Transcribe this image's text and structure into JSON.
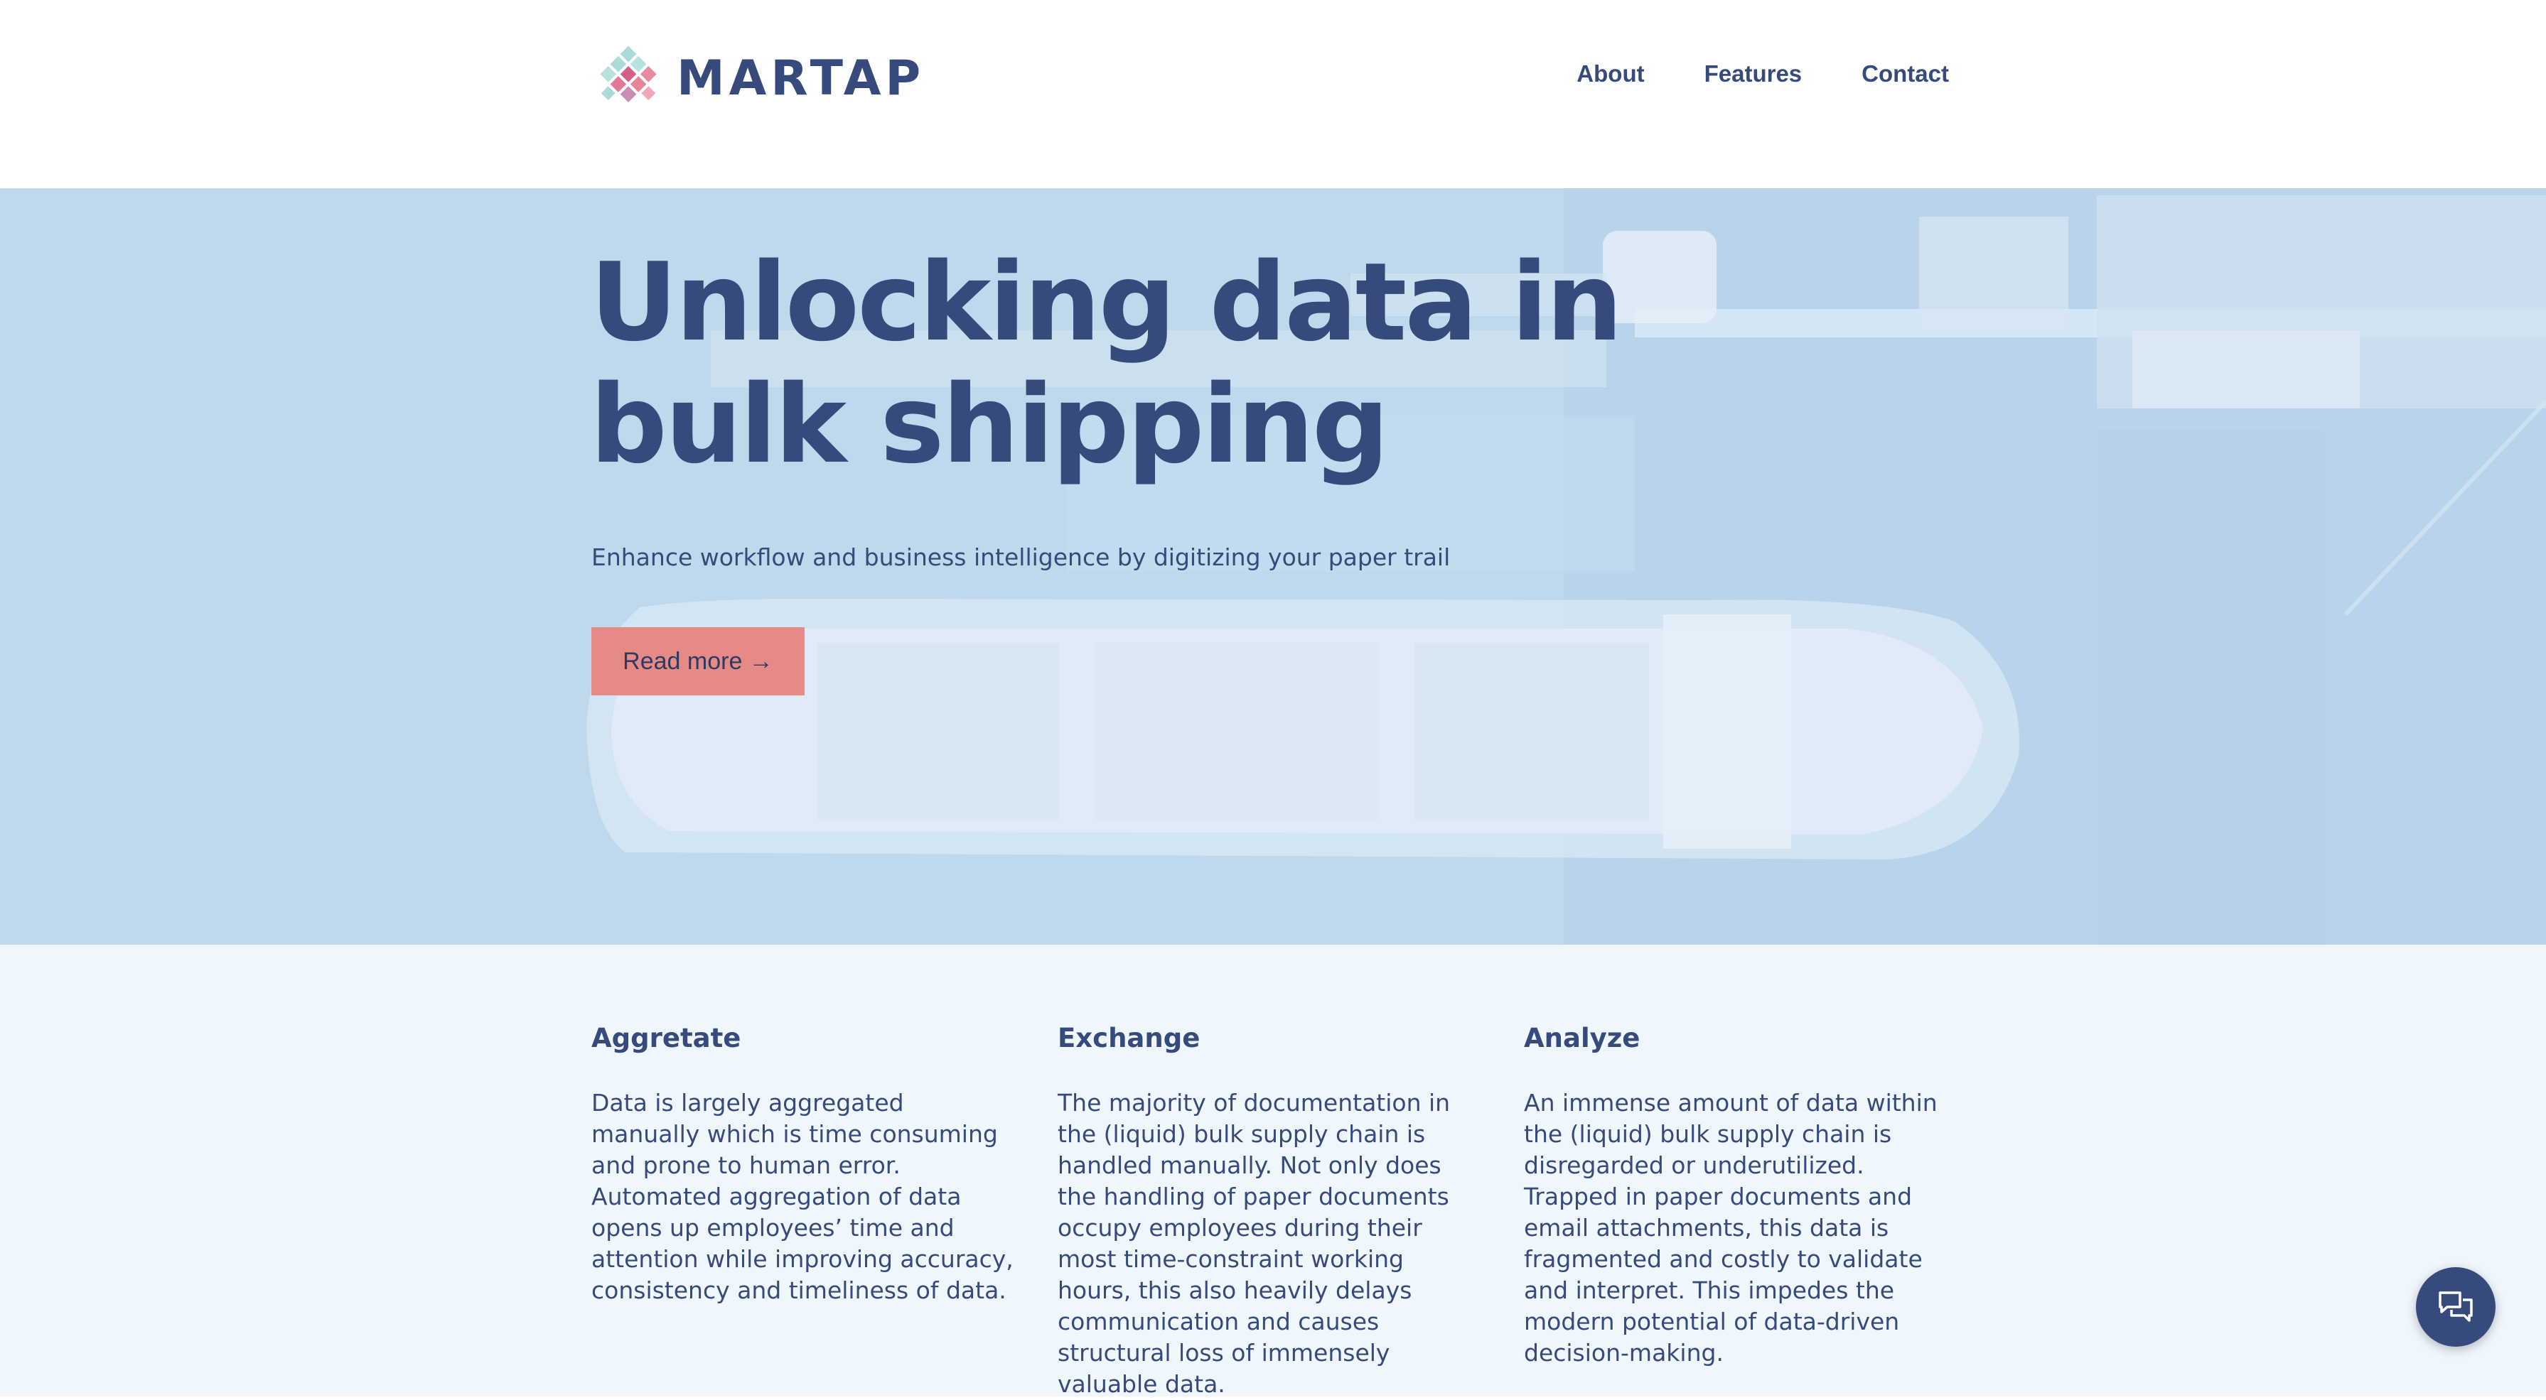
{
  "brand": {
    "name": "MARTAP"
  },
  "nav": {
    "items": [
      "About",
      "Features",
      "Contact"
    ]
  },
  "hero": {
    "title_line1": "Unlocking data in",
    "title_line2": "bulk shipping",
    "subtitle": "Enhance workflow and business intelligence by digitizing your paper trail",
    "cta_label": "Read more →"
  },
  "features": [
    {
      "title": "Aggretate",
      "body": "Data is largely aggregated manually which is time consuming and prone to human error. Automated aggregation of data opens up employees’ time and attention while improving accuracy, consistency and timeliness of data."
    },
    {
      "title": "Exchange",
      "body": "The majority of documentation in the (liquid) bulk supply chain is handled manually. Not only does the handling of paper documents occupy employees during their most time-constraint working hours, this also heavily delays communication and causes structural loss of immensely valuable data."
    },
    {
      "title": "Analyze",
      "body": "An immense amount of data within the (liquid) bulk supply chain is disregarded or underutilized. Trapped in paper documents and email attachments, this data is fragmented and costly to validate and interpret. This impedes the modern potential of data-driven decision-making."
    }
  ],
  "icons": {
    "logo": "diamond-grid-logo-icon",
    "chat": "chat-bubbles-icon",
    "hero_image": "tanker-ship-aerial-image"
  },
  "colors": {
    "primary": "#364a7c",
    "accent": "#e58a85",
    "hero_bg": "#bfd8ec",
    "section_bg": "#eff6fc"
  }
}
